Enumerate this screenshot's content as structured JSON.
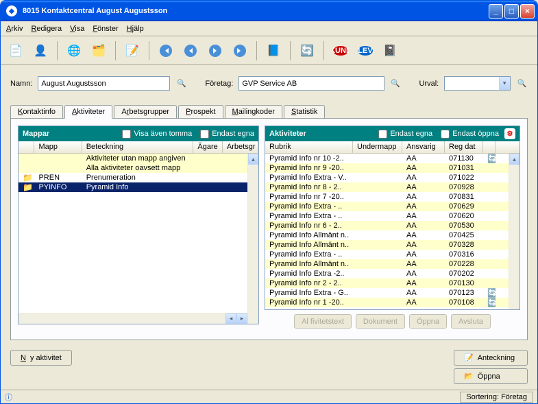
{
  "window": {
    "title": "8015 Kontaktcentral August Augustsson"
  },
  "menu": {
    "arkiv": "Arkiv",
    "redigera": "Redigera",
    "visa": "Visa",
    "fonster": "Fönster",
    "hjalp": "Hjälp"
  },
  "filter": {
    "namn_label": "Namn:",
    "namn_value": "August Augustsson",
    "foretag_label": "Företag:",
    "foretag_value": "GVP Service AB",
    "urval_label": "Urval:",
    "urval_value": ""
  },
  "tabs": {
    "kontaktinfo": "Kontaktinfo",
    "aktiviteter": "Aktiviteter",
    "arbetsgrupper": "Arbetsgrupper",
    "prospekt": "Prospekt",
    "mailingkoder": "Mailingkoder",
    "statistik": "Statistik"
  },
  "folders": {
    "title": "Mappar",
    "chk1": "Visa även tomma",
    "chk2": "Endast egna",
    "headers": {
      "mapp": "Mapp",
      "beteckning": "Beteckning",
      "agare": "Ägare",
      "arbetsgr": "Arbetsgr"
    },
    "rows": [
      {
        "mapp": "",
        "beteckning": "Aktiviteter utan mapp angiven",
        "icon": false,
        "sel": false,
        "alt": true
      },
      {
        "mapp": "",
        "beteckning": "Alla aktiviteter oavsett mapp",
        "icon": false,
        "sel": false,
        "alt": true
      },
      {
        "mapp": "PREN",
        "beteckning": "Prenumeration",
        "icon": true,
        "sel": false,
        "alt": false
      },
      {
        "mapp": "PYINFO",
        "beteckning": "Pyramid Info",
        "icon": true,
        "sel": true,
        "alt": false
      }
    ]
  },
  "activities": {
    "title": "Aktiviteter",
    "chk1": "Endast egna",
    "chk2": "Endast öppna",
    "headers": {
      "rubrik": "Rubrik",
      "undermapp": "Undermapp",
      "ansvarig": "Ansvarig",
      "regdat": "Reg dat"
    },
    "rows": [
      {
        "rubrik": "Pyramid Info nr 10 -2..",
        "ansvarig": "AA",
        "reg": "071130",
        "alt": false
      },
      {
        "rubrik": "Pyramid Info nr 9 -20..",
        "ansvarig": "AA",
        "reg": "071031",
        "alt": true
      },
      {
        "rubrik": "Pyramid Info Extra - V..",
        "ansvarig": "AA",
        "reg": "071022",
        "alt": false
      },
      {
        "rubrik": "Pyramid Info nr 8 - 2..",
        "ansvarig": "AA",
        "reg": "070928",
        "alt": true
      },
      {
        "rubrik": "Pyramid Info nr 7 -20..",
        "ansvarig": "AA",
        "reg": "070831",
        "alt": false
      },
      {
        "rubrik": "Pyramid Info Extra - ..",
        "ansvarig": "AA",
        "reg": "070629",
        "alt": true
      },
      {
        "rubrik": "Pyramid Info Extra - ..",
        "ansvarig": "AA",
        "reg": "070620",
        "alt": false
      },
      {
        "rubrik": "Pyramid Info nr 6 - 2..",
        "ansvarig": "AA",
        "reg": "070530",
        "alt": true
      },
      {
        "rubrik": "Pyramid Info Allmänt n..",
        "ansvarig": "AA",
        "reg": "070425",
        "alt": false
      },
      {
        "rubrik": "Pyramid Info Allmänt n..",
        "ansvarig": "AA",
        "reg": "070328",
        "alt": true
      },
      {
        "rubrik": "Pyramid Info Extra - ..",
        "ansvarig": "AA",
        "reg": "070316",
        "alt": false
      },
      {
        "rubrik": "Pyramid Info Allmänt n..",
        "ansvarig": "AA",
        "reg": "070228",
        "alt": true
      },
      {
        "rubrik": "Pyramid Info Extra -2..",
        "ansvarig": "AA",
        "reg": "070202",
        "alt": false
      },
      {
        "rubrik": "Pyramid Info nr 2 - 2..",
        "ansvarig": "AA",
        "reg": "070130",
        "alt": true
      },
      {
        "rubrik": "Pyramid Info Extra - G..",
        "ansvarig": "AA",
        "reg": "070123",
        "alt": false
      },
      {
        "rubrik": "Pyramid Info nr 1 -20..",
        "ansvarig": "AA",
        "reg": "070108",
        "alt": true
      }
    ],
    "btns": {
      "fritext": "Al fivitetstext",
      "dokument": "Dokument",
      "oppna": "Öppna",
      "avsluta": "Avsluta"
    }
  },
  "bottom": {
    "ny": "Ny aktivitet",
    "anteckning": "Anteckning",
    "oppna": "Öppna"
  },
  "status": {
    "sort": "Sortering: Företag"
  }
}
